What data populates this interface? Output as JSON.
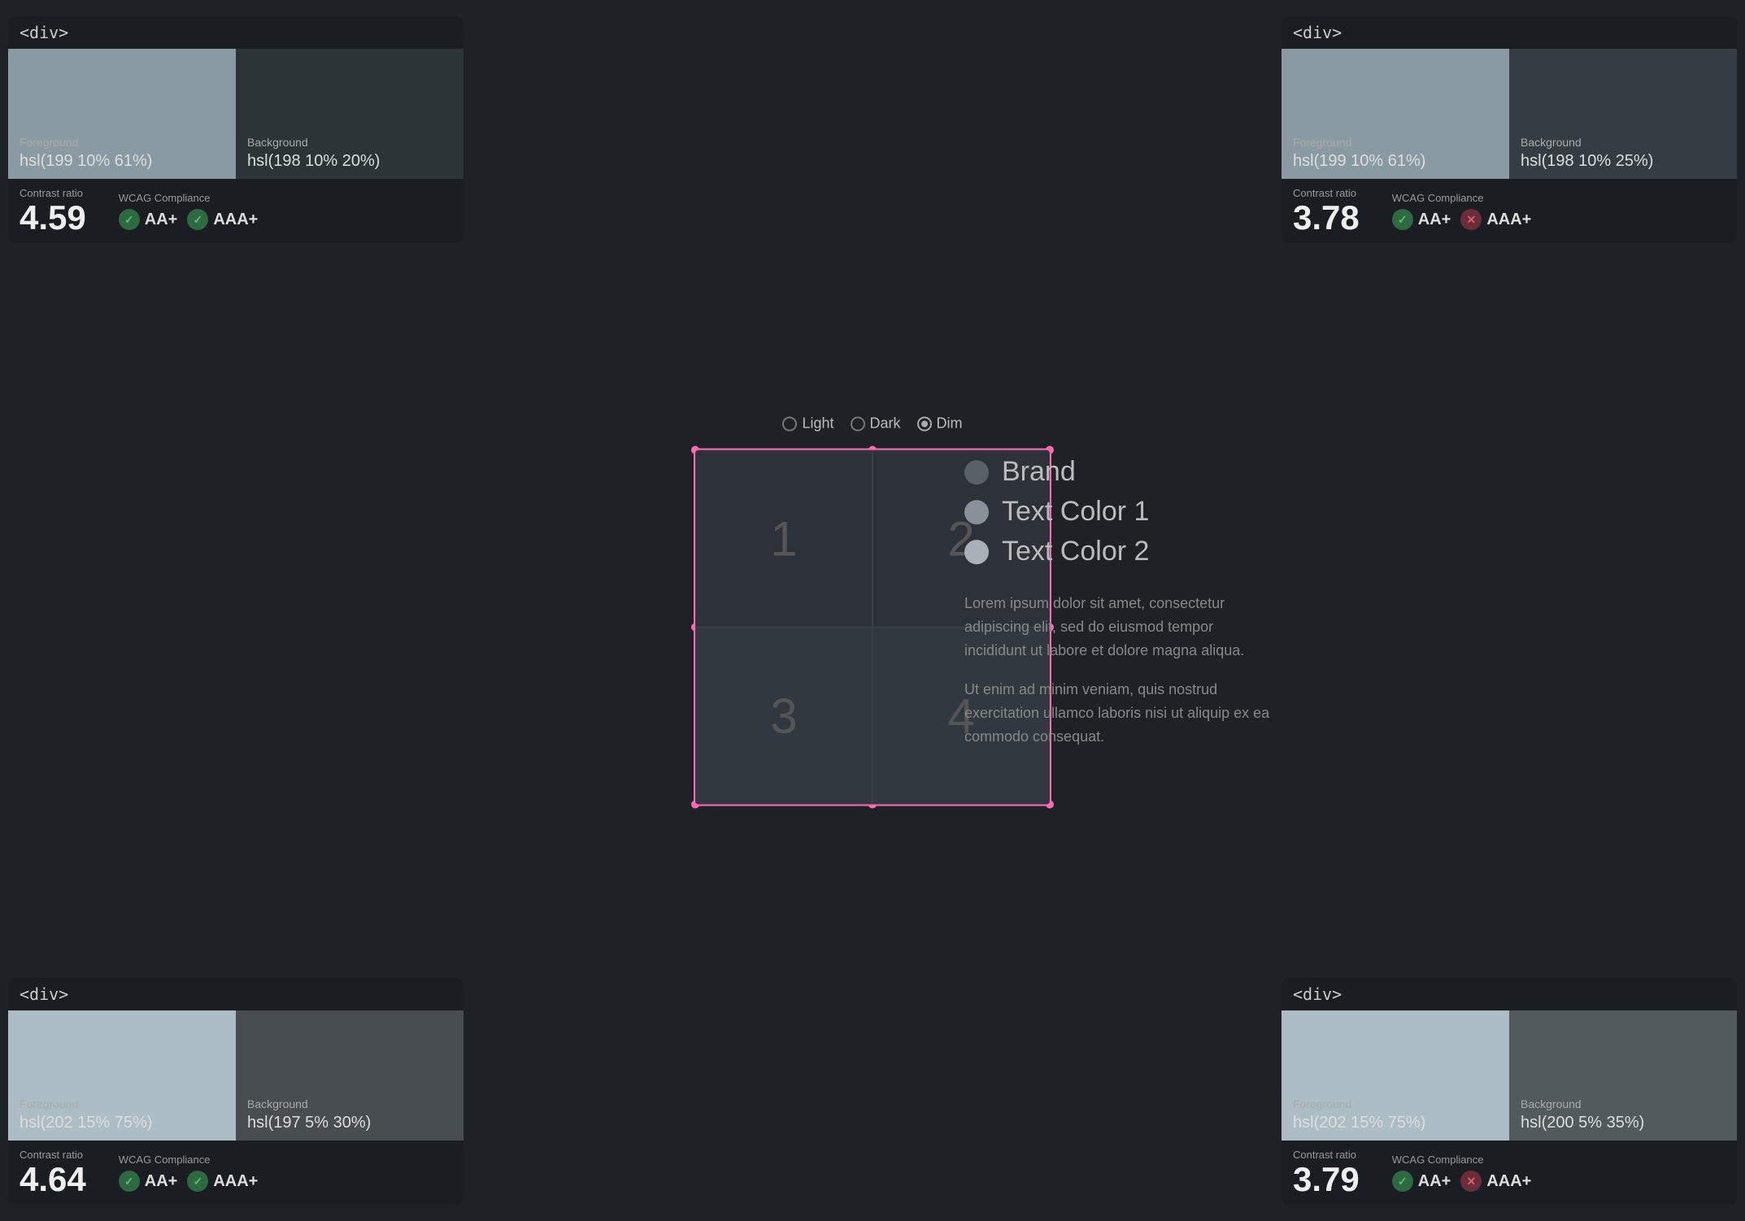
{
  "panels": {
    "tl": {
      "header": "<div>",
      "fg_label": "Foreground",
      "fg_value": "hsl(199 10% 61%)",
      "fg_color": "#8a9aa3",
      "bg_label": "Background",
      "bg_value": "hsl(198 10% 20%)",
      "bg_color": "#2d3438",
      "contrast_label": "Contrast ratio",
      "contrast_value": "4.59",
      "wcag_label": "WCAG Compliance",
      "badge1": "AA+",
      "badge1_pass": true,
      "badge2": "AAA+",
      "badge2_pass": true
    },
    "tr": {
      "header": "<div>",
      "fg_label": "Foreground",
      "fg_value": "hsl(199 10% 61%)",
      "fg_color": "#8a9aa3",
      "bg_label": "Background",
      "bg_value": "hsl(198 10% 25%)",
      "bg_color": "#363d42",
      "contrast_label": "Contrast ratio",
      "contrast_value": "3.78",
      "wcag_label": "WCAG Compliance",
      "badge1": "AA+",
      "badge1_pass": true,
      "badge2": "AAA+",
      "badge2_pass": false
    },
    "bl": {
      "header": "<div>",
      "fg_label": "Foreground",
      "fg_value": "hsl(202 15% 75%)",
      "fg_color": "#adbdc5",
      "bg_label": "Background",
      "bg_value": "hsl(197 5% 30%)",
      "bg_color": "#474d50",
      "contrast_label": "Contrast ratio",
      "contrast_value": "4.64",
      "wcag_label": "WCAG Compliance",
      "badge1": "AA+",
      "badge1_pass": true,
      "badge2": "AAA+",
      "badge2_pass": true
    },
    "br": {
      "header": "<div>",
      "fg_label": "Foreground",
      "fg_value": "hsl(202 15% 75%)",
      "fg_color": "#adbdc5",
      "bg_label": "Background",
      "bg_value": "hsl(200 5% 35%)",
      "bg_color": "#535a5e",
      "contrast_label": "Contrast ratio",
      "contrast_value": "3.79",
      "wcag_label": "WCAG Compliance",
      "badge1": "AA+",
      "badge1_pass": true,
      "badge2": "AAA+",
      "badge2_pass": false
    }
  },
  "theme_switcher": {
    "options": [
      "Light",
      "Dark",
      "Dim"
    ],
    "selected": "Dim"
  },
  "grid": {
    "cells": [
      "1",
      "2",
      "3",
      "4"
    ]
  },
  "legend": {
    "items": [
      {
        "name": "Brand",
        "class": "brand"
      },
      {
        "name": "Text Color 1",
        "class": "text1"
      },
      {
        "name": "Text Color 2",
        "class": "text2"
      }
    ]
  },
  "lorem": {
    "p1": "Lorem ipsum dolor sit amet, consectetur adipiscing elit, sed do eiusmod tempor incididunt ut labore et dolore magna aliqua.",
    "p2": "Ut enim ad minim veniam, quis nostrud exercitation ullamco laboris nisi ut aliquip ex ea commodo consequat."
  }
}
